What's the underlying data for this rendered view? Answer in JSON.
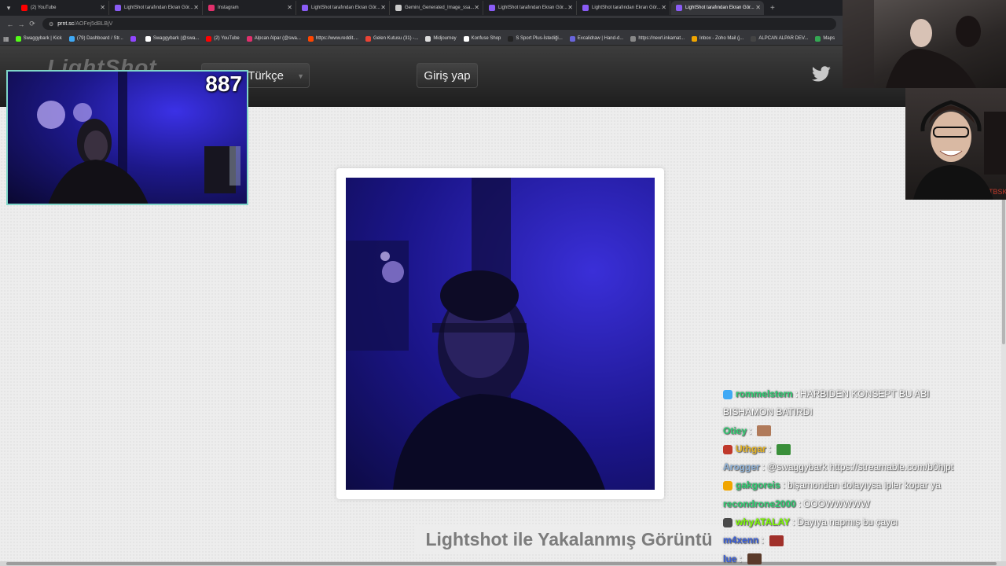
{
  "browser": {
    "tabs": [
      {
        "title": "(2) YouTube",
        "favicon_color": "#ff0000",
        "active": false
      },
      {
        "title": "LightShot tarafından Ekran Gör...",
        "favicon_color": "#8a5cf5",
        "active": false
      },
      {
        "title": "Instagram",
        "favicon_color": "#e1306c",
        "active": false
      },
      {
        "title": "LightShot tarafından Ekran Gör...",
        "favicon_color": "#8a5cf5",
        "active": false
      },
      {
        "title": "Gemini_Generated_Image_ssa...",
        "favicon_color": "#cccccc",
        "active": false
      },
      {
        "title": "LightShot tarafından Ekran Gör...",
        "favicon_color": "#8a5cf5",
        "active": false
      },
      {
        "title": "LightShot tarafından Ekran Gör...",
        "favicon_color": "#8a5cf5",
        "active": false
      },
      {
        "title": "LightShot tarafından Ekran Gör...",
        "favicon_color": "#8a5cf5",
        "active": true
      }
    ],
    "url_domain": "prnt.sc",
    "url_path": "/AOFej5dBLBjV",
    "bookmarks": [
      {
        "label": "Swaggybark | Kick",
        "icon_color": "#53fc18"
      },
      {
        "label": "(79) Dashboard / Str...",
        "icon_color": "#3fa9f5"
      },
      {
        "label": "",
        "icon_color": "#9146ff"
      },
      {
        "label": "Swaggybark (@swa...",
        "icon_color": "#ffffff"
      },
      {
        "label": "(2) YouTube",
        "icon_color": "#ff0000"
      },
      {
        "label": "Alpcan Alpar (@swa...",
        "icon_color": "#e1306c"
      },
      {
        "label": "https://www.reddit....",
        "icon_color": "#ff4500"
      },
      {
        "label": "Gelen Kutusu (31) -...",
        "icon_color": "#ea4335"
      },
      {
        "label": "Midjourney",
        "icon_color": "#dddddd"
      },
      {
        "label": "Konfuse Shop",
        "icon_color": "#ffffff"
      },
      {
        "label": "S Sport Plus-İstediği...",
        "icon_color": "#222222"
      },
      {
        "label": "Excalidraw | Hand-d...",
        "icon_color": "#6965db"
      },
      {
        "label": "https://nexrl.inkamat...",
        "icon_color": "#888888"
      },
      {
        "label": "Inbox - Zoho Mail (j...",
        "icon_color": "#f0a500"
      },
      {
        "label": "ALPCAN ALPAR DEV...",
        "icon_color": "#444444"
      },
      {
        "label": "Maps",
        "icon_color": "#34a853"
      }
    ]
  },
  "lightshot": {
    "logo_text": "LightShot",
    "language": "Türkçe",
    "login_label": "Giriş yap",
    "caption": "Lightshot ile Yakalanmış Görüntü"
  },
  "stream": {
    "viewer_count": "887"
  },
  "chat": [
    {
      "user": "rommelstern",
      "user_color": "#2ecc71",
      "badge_color": "#3fa9f5",
      "text": "HARBIDEN KONSEPT BU ABI",
      "emote": ""
    },
    {
      "user": "",
      "user_color": "#ffffff",
      "badge_color": "",
      "text": "BISHAMON BATIRDI",
      "emote": ""
    },
    {
      "user": "Otiey",
      "user_color": "#2ecc71",
      "badge_color": "",
      "text": "",
      "emote": "#b07a5a"
    },
    {
      "user": "Uthgar",
      "user_color": "#e6b422",
      "badge_color": "#c0392b",
      "text": "",
      "emote": "#3a8f3a"
    },
    {
      "user": "Arogger",
      "user_color": "#8fb3d9",
      "badge_color": "",
      "text": "@swaggybark https://streamable.com/b0hjpt",
      "emote": ""
    },
    {
      "user": "gakgoreis",
      "user_color": "#2ecc71",
      "badge_color": "#f0a500",
      "text": "bişamondan dolayıysa ipler kopar ya",
      "emote": ""
    },
    {
      "user": "recondrone2000",
      "user_color": "#2ecc71",
      "badge_color": "",
      "text": "OOOWWWWW",
      "emote": ""
    },
    {
      "user": "whyATALAY",
      "user_color": "#7cfc00",
      "badge_color": "#4a4a4a",
      "text": "Dayıya napmış bu çaycı",
      "emote": ""
    },
    {
      "user": "m4xenn",
      "user_color": "#3a5fd9",
      "badge_color": "",
      "text": "",
      "emote": "#a0302a"
    },
    {
      "user": "lue",
      "user_color": "#3a5fd9",
      "badge_color": "",
      "text": "",
      "emote": "#5a3a2a"
    }
  ]
}
